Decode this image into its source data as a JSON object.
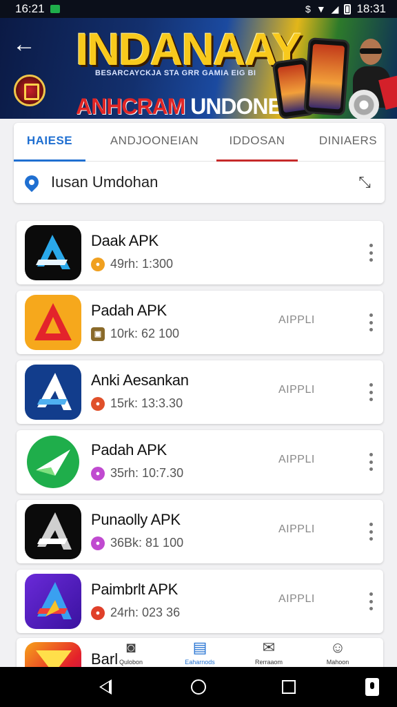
{
  "status_bar": {
    "time_left": "16:21",
    "time_right": "18:31"
  },
  "banner": {
    "title": "INDANAAY",
    "tagline": "BESARCAYCKJA STA GRR GAMIA EIG BI",
    "subtitle_red": "ANHCRAM",
    "subtitle_white": "UNDONESIA"
  },
  "tabs": [
    {
      "label": "HAIESE"
    },
    {
      "label": "ANDJOONEIAN"
    },
    {
      "label": "IDDOSAN"
    },
    {
      "label": "DINIAERS"
    }
  ],
  "location": {
    "text": "Iusan Umdohan"
  },
  "apps": [
    {
      "name": "Daak APK",
      "meta": "49rh: 1:300",
      "badge": "",
      "meta_dot": "#f0a020"
    },
    {
      "name": "Padah APK",
      "meta": "10rk: 62 100",
      "badge": "AIPPLI",
      "meta_dot": "#8a6a2a"
    },
    {
      "name": "Anki Aesankan",
      "meta": "15rk: 13:3.30",
      "badge": "AIPPLI",
      "meta_dot": "#e0502a"
    },
    {
      "name": "Padah APK",
      "meta": "35rh: 10:7.30",
      "badge": "AIPPLI",
      "meta_dot": "#c04ad0"
    },
    {
      "name": "Punaolly APK",
      "meta": "36Bk: 81 100",
      "badge": "AIPPLI",
      "meta_dot": "#c04ad0"
    },
    {
      "name": "Paimbrlt APK",
      "meta": "24rh: 023 36",
      "badge": "AIPPLI",
      "meta_dot": "#e0402a"
    }
  ],
  "partial_app": {
    "name": "Barl"
  },
  "bottom_nav": [
    {
      "label": "Qulobon",
      "icon": "camera-icon"
    },
    {
      "label": "Eaharnods",
      "icon": "document-icon"
    },
    {
      "label": "Rerraaom",
      "icon": "bookmark-icon"
    },
    {
      "label": "Mahoon",
      "icon": "profile-icon"
    }
  ],
  "colors": {
    "accent_blue": "#1f6fd1",
    "accent_red": "#c62a2a",
    "banner_gold": "#f8c91c"
  }
}
